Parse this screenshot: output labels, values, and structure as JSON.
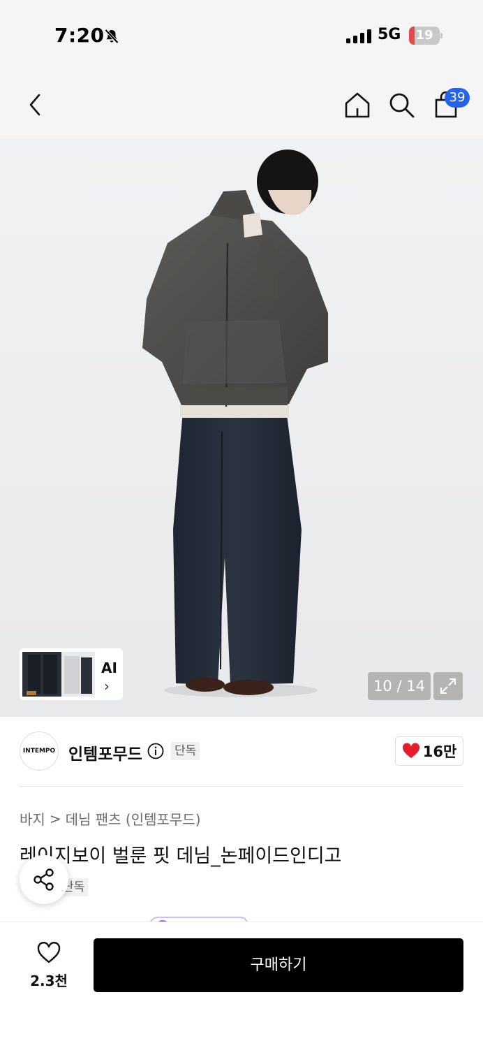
{
  "status_bar": {
    "time": "7:20",
    "network": "5G",
    "battery": "19",
    "battery_level": 0.19
  },
  "header": {
    "cart_count": "39"
  },
  "gallery": {
    "counter": "10 / 14",
    "ai_label": "AI"
  },
  "brand": {
    "logo_text": "INTEMPO",
    "name": "인템포무드",
    "badge": "단독",
    "likes": "16만"
  },
  "breadcrumb": {
    "category": "바지",
    "separator": ">",
    "subcategory": "데님 팬츠 (인템포무드)"
  },
  "product": {
    "title": "레이지보이 벌룬 핏 데님_논페이드인디고",
    "badge": "단독"
  },
  "bottom_bar": {
    "wish_count": "2.3천",
    "buy_label": "구매하기"
  },
  "colors": {
    "accent_blue": "#2563eb",
    "heart_red": "#e11d2e",
    "buy_black": "#000000"
  }
}
